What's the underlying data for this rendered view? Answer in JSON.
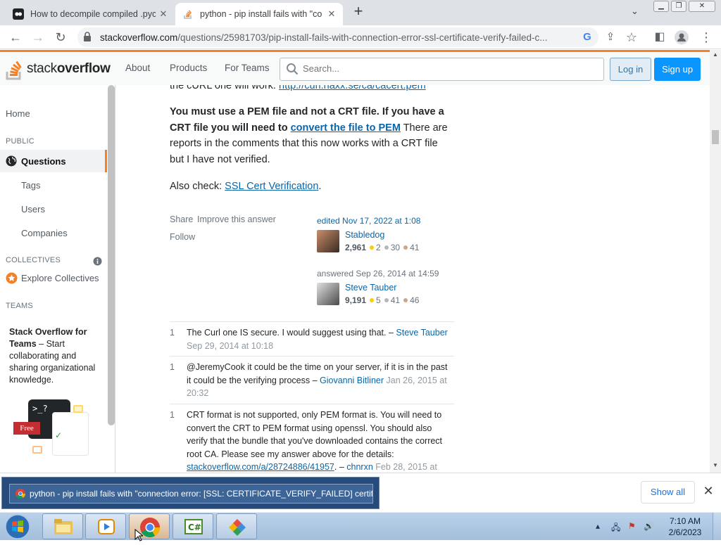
{
  "browser": {
    "tabs": [
      {
        "title": "How to decompile compiled .pyc",
        "favicon": "ai-logo-icon"
      },
      {
        "title": "python - pip install fails with \"co",
        "favicon": "stackoverflow-icon"
      }
    ],
    "url_host": "stackoverflow.com",
    "url_path": "/questions/25981703/pip-install-fails-with-connection-error-ssl-certificate-verify-failed-c..."
  },
  "header": {
    "logo_text_light": "stack",
    "logo_text_bold": "overflow",
    "nav": [
      "About",
      "Products",
      "For Teams"
    ],
    "search_placeholder": "Search...",
    "login": "Log in",
    "signup": "Sign up"
  },
  "sidebar": {
    "home": "Home",
    "public_heading": "PUBLIC",
    "questions": "Questions",
    "tags": "Tags",
    "users": "Users",
    "companies": "Companies",
    "collectives_heading": "COLLECTIVES",
    "explore_collectives": "Explore Collectives",
    "teams_heading": "TEAMS",
    "teams_title": "Stack Overflow for Teams",
    "teams_text": " – Start collaborating and sharing organizational knowledge.",
    "free_badge": "Free"
  },
  "answer": {
    "top_clipped_text": "the cURL one will work.",
    "top_clipped_link": "http://curl.haxx.se/ca/cacert.pem",
    "para1_bold": "You must use a PEM file and not a CRT file. If you have a CRT file you will need to",
    "para1_link": "convert the file to PEM",
    "para1_rest": " There are reports in the comments that this now works with a CRT file but I have not verified.",
    "para2_text": "Also check: ",
    "para2_link": "SSL Cert Verification",
    "para2_end": ".",
    "share": "Share",
    "improve": "Improve this answer",
    "follow": "Follow",
    "editor": {
      "action": "edited Nov 17, 2022 at 1:08",
      "name": "Stabledog",
      "rep": "2,961",
      "gold": "2",
      "silver": "30",
      "bronze": "41"
    },
    "author": {
      "action": "answered Sep 26, 2014 at 14:59",
      "name": "Steve Tauber",
      "rep": "9,191",
      "gold": "5",
      "silver": "41",
      "bronze": "46"
    }
  },
  "comments": [
    {
      "score": "1",
      "text": "The Curl one IS secure. I would suggest using that. – ",
      "user": "Steve Tauber",
      "date": " Sep 29, 2014 at 10:18"
    },
    {
      "score": "1",
      "text": "@JeremyCook it could be the time on your server, if it is in the past it could be the verifying process – ",
      "user": "Giovanni Bitliner",
      "date": " Jan 26, 2015 at 20:32"
    },
    {
      "score": "1",
      "text": "CRT format is not supported, only PEM format is. You should also verify that the bundle that you've downloaded contains the correct root CA. Please see my answer above for the details: ",
      "link": "stackoverflow.com/a/28724886/41957",
      "sep": ". – ",
      "user": "chnrxn",
      "date": " Feb 28, 2015 at",
      "text_prefix": "CRT format is not supported, only PEM format is. You will need to convert the CRT to PEM format using openssl. You should also verify that the bundle that you've downloaded contains the correct root CA. Please see my answer above for the details: "
    }
  ],
  "downloads": {
    "item": "python - pip install fails with \"connection error: [SSL: CERTIFICATE_VERIFY_FAILED] certific...",
    "show_all": "Show all"
  },
  "taskbar": {
    "time": "7:10 AM",
    "date": "2/6/2023"
  },
  "colors": {
    "accent_orange": "#f48225",
    "link_blue": "#0a66a8",
    "signup_blue": "#0a95ff",
    "gold": "#ffcc01",
    "silver": "#b4b8bc",
    "bronze": "#d1a684"
  }
}
